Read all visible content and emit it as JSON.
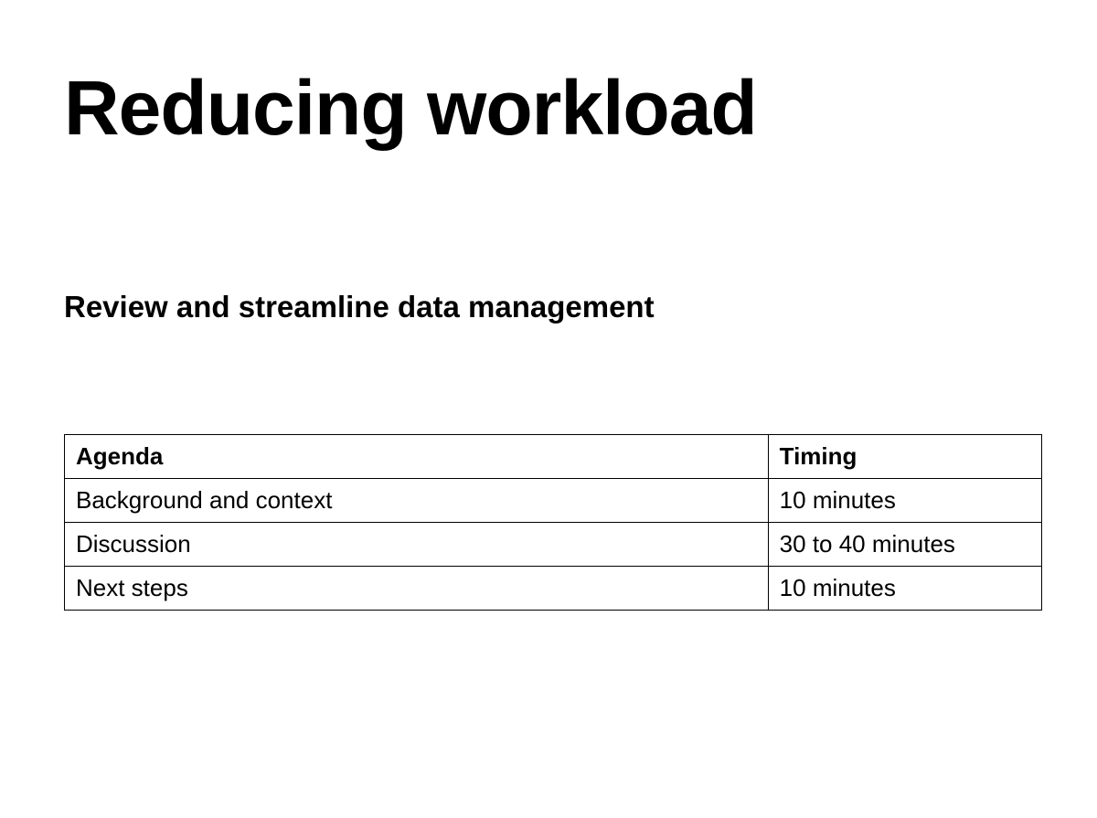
{
  "title": "Reducing workload",
  "subtitle": "Review and streamline data management",
  "table": {
    "headers": {
      "agenda": "Agenda",
      "timing": "Timing"
    },
    "rows": [
      {
        "agenda": "Background and context",
        "timing": "10 minutes"
      },
      {
        "agenda": "Discussion",
        "timing": "30 to 40 minutes"
      },
      {
        "agenda": "Next steps",
        "timing": "10 minutes"
      }
    ]
  }
}
